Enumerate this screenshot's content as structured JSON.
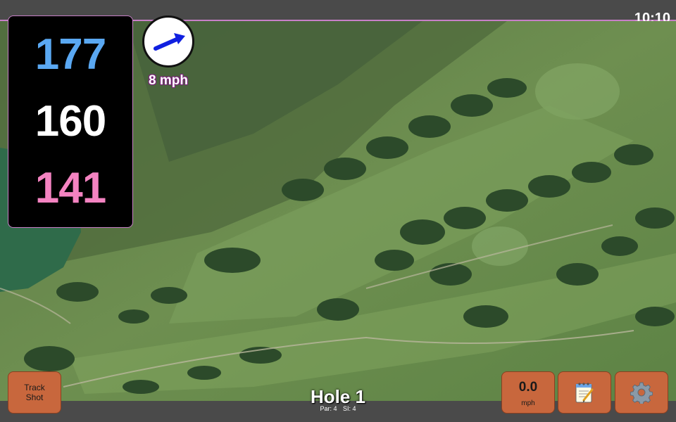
{
  "status": {
    "time": "10:10"
  },
  "distances": {
    "back": "177",
    "middle": "160",
    "front": "141"
  },
  "wind": {
    "speed_label": "8 mph",
    "direction_icon": "arrow-right-up-icon",
    "arrow_color": "#1020e0"
  },
  "buttons": {
    "track_shot_line1": "Track",
    "track_shot_line2": "Shot",
    "speed_value": "0.0",
    "speed_unit": "mph",
    "notes_icon": "notepad-icon",
    "settings_icon": "gear-icon"
  },
  "hole": {
    "title": "Hole 1",
    "par": "Par: 4",
    "si": "SI: 4"
  },
  "colors": {
    "panel_border": "#c77fc7",
    "back_distance": "#5aa8f2",
    "middle_distance": "#ffffff",
    "front_distance": "#f483c1",
    "button_bg": "#c8673d",
    "bar_bg": "#4a4a4a"
  }
}
